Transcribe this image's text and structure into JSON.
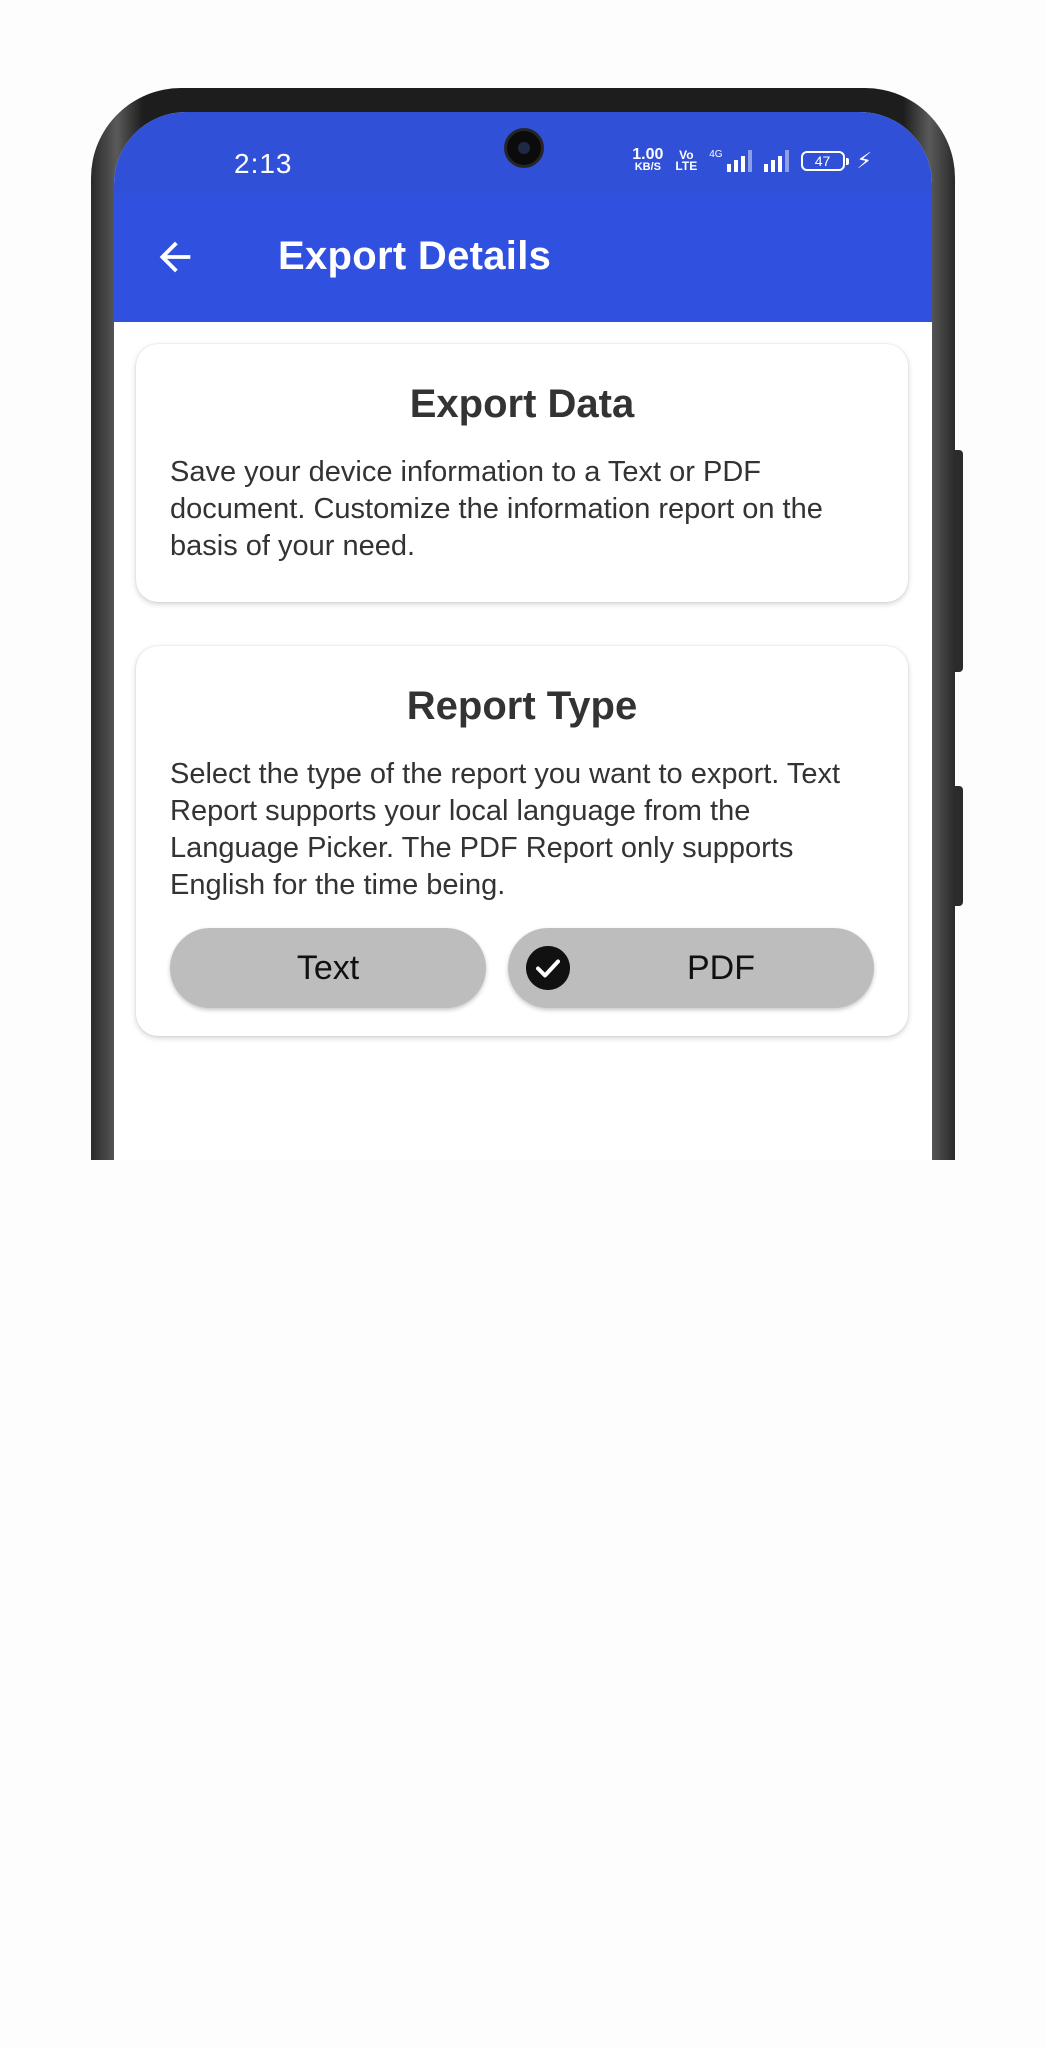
{
  "status_bar": {
    "time": "2:13",
    "net_speed_value": "1.00",
    "net_speed_unit": "KB/S",
    "volte_top": "Vo",
    "volte_bottom": "LTE",
    "network_type": "4G",
    "battery_level": "47",
    "icons": [
      "signal-icon",
      "signal-icon",
      "battery-icon",
      "charging-bolt-icon"
    ]
  },
  "app_bar": {
    "title": "Export Details",
    "back_icon": "arrow-left-icon"
  },
  "export_card": {
    "title": "Export Data",
    "body": "Save your device information to a Text or PDF document. Customize the information report on the basis of your need."
  },
  "report_card": {
    "title": "Report Type",
    "body": "Select the type of the report you want to export. Text Report supports your local language from the Language Picker. The PDF Report only supports English for the time being.",
    "options": [
      {
        "label": "Text",
        "selected": false
      },
      {
        "label": "PDF",
        "selected": true,
        "icon": "check-circle-icon"
      }
    ]
  },
  "colors": {
    "status_bar": "#3050d8",
    "app_bar": "#3050e0",
    "pill": "#bdbdbd",
    "text": "#333333"
  }
}
